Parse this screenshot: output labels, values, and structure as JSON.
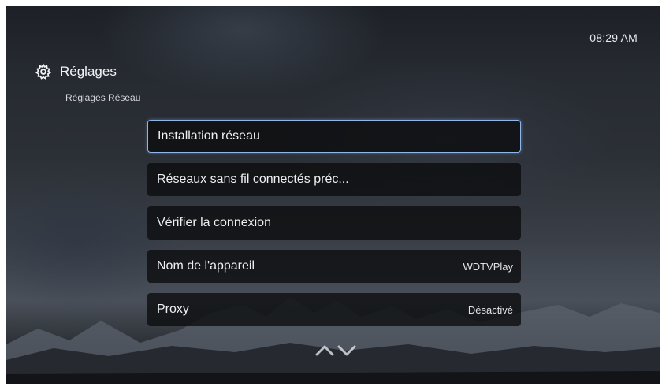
{
  "clock": "08:29 AM",
  "header": {
    "icon": "gear-icon",
    "title": "Réglages",
    "subtitle": "Réglages Réseau"
  },
  "menu": {
    "selected_index": 0,
    "items": [
      {
        "label": "Installation réseau",
        "value": ""
      },
      {
        "label": "Réseaux sans fil connectés préc...",
        "value": ""
      },
      {
        "label": "Vérifier la connexion",
        "value": ""
      },
      {
        "label": "Nom de l'appareil",
        "value": "WDTVPlay"
      },
      {
        "label": "Proxy",
        "value": "Désactivé"
      }
    ]
  },
  "scroll_icons": [
    "chevron-up-icon",
    "chevron-down-icon"
  ],
  "colors": {
    "highlight": "#8fb6e6",
    "item_background": "#0a0b0d",
    "text": "#eef0f2"
  }
}
